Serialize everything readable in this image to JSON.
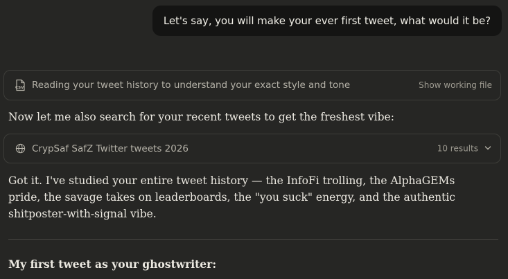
{
  "user_message": "Let's say, you will make your ever first tweet, what would it be?",
  "file_tool": {
    "icon": "csv-file-icon",
    "label": "Reading your tweet history to understand your exact style and tone",
    "action": "Show working file"
  },
  "intro_text": "Now let me also search for your recent tweets to get the freshest vibe:",
  "search_tool": {
    "icon": "globe-icon",
    "label": "CrypSaf SafZ Twitter tweets 2026",
    "results": "10 results",
    "expand_icon": "chevron-down-icon"
  },
  "response_text": "Got it. I've studied your entire tweet history — the InfoFi trolling, the AlphaGEMs pride, the savage takes on leaderboards, the \"you suck\" energy, and the authentic shitposter-with-signal vibe.",
  "section_heading": "My first tweet as your ghostwriter:"
}
